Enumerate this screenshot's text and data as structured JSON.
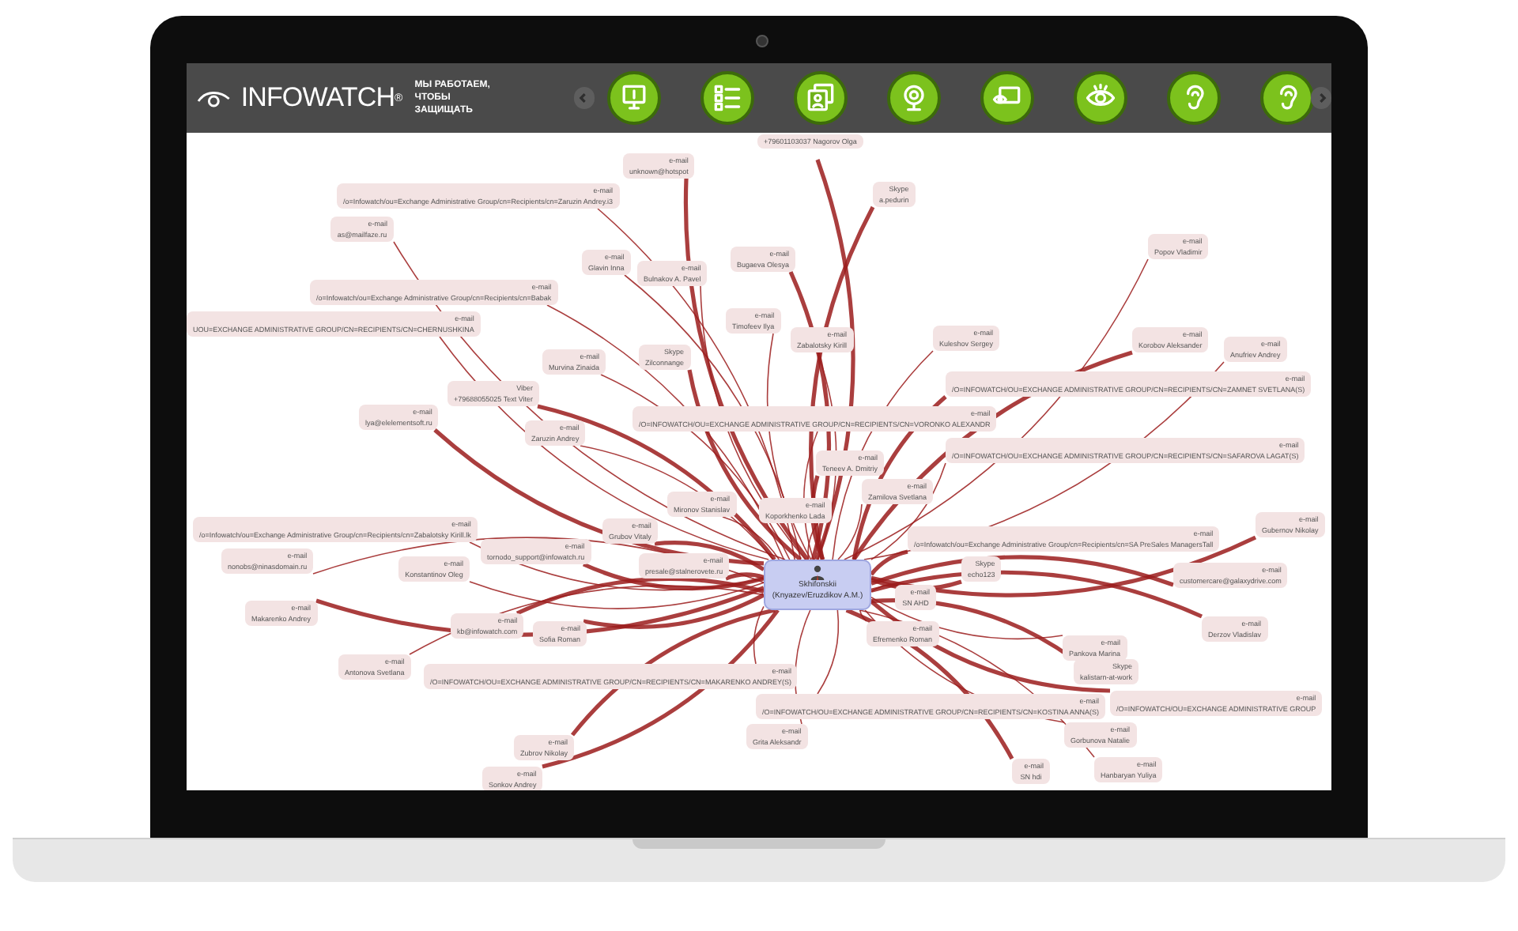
{
  "header": {
    "brand": "INFOWATCH",
    "brand_mark": "®",
    "tagline": [
      "МЫ РАБОТАЕМ,",
      "ЧТОБЫ ЗАЩИЩАТЬ"
    ],
    "toolbar": [
      {
        "kind": "monitor"
      },
      {
        "kind": "list"
      },
      {
        "kind": "cards"
      },
      {
        "kind": "webcam"
      },
      {
        "kind": "eye-screen"
      },
      {
        "kind": "eye"
      },
      {
        "kind": "ear"
      },
      {
        "kind": "ear"
      }
    ]
  },
  "hub": {
    "name": "Skhifonskii",
    "detail": "(Knyazev/Eruzdikov A.M.)"
  },
  "nodes": [
    {
      "type": "e-mail",
      "value": "unknown@hotspot",
      "kind": "thick"
    },
    {
      "type": "e-mail",
      "value": "/o=Infowatch/ou=Exchange Administrative Group/cn=Recipients/cn=Zaruzin Andrey.i3",
      "kind": "thin"
    },
    {
      "type": "e-mail",
      "value": "as@mailfaze.ru",
      "kind": "thin"
    },
    {
      "type": "e-mail",
      "value": "Glavin Inna",
      "kind": "thin"
    },
    {
      "type": "e-mail",
      "value": "Bulnakov A. Pavel",
      "kind": "thin"
    },
    {
      "type": "e-mail",
      "value": "/o=Infowatch/ou=Exchange Administrative Group/cn=Recipients/cn=Babak",
      "kind": "thin"
    },
    {
      "type": "e-mail",
      "value": "UOU=EXCHANGE ADMINISTRATIVE GROUP/CN=RECIPIENTS/CN=CHERNUSHKINA",
      "kind": "thin"
    },
    {
      "type": "e-mail",
      "value": "Murvina Zinaida",
      "kind": "thin"
    },
    {
      "type": "Skype",
      "value": "Zilconnange",
      "kind": "thick"
    },
    {
      "type": "Viber",
      "value": "+79688055025 Text Viter",
      "kind": "thick"
    },
    {
      "type": "e-mail",
      "value": "lya@elelementsoft.ru",
      "kind": "thick"
    },
    {
      "type": "e-mail",
      "value": "Zaruzin Andrey",
      "kind": "thin"
    },
    {
      "type": "e-mail",
      "value": "/O=INFOWATCH/OU=EXCHANGE ADMINISTRATIVE GROUP/CN=RECIPIENTS/CN=VORONKO ALEXANDR",
      "kind": "thin"
    },
    {
      "type": "e-mail",
      "value": "Bugaeva Olesya",
      "kind": "thick"
    },
    {
      "type": "e-mail",
      "value": "Timofeev Ilya",
      "kind": "thin"
    },
    {
      "value": "+79601103037 Nagorov Olga",
      "kind": "thick"
    },
    {
      "type": "Skype",
      "value": "a.pedurin",
      "kind": "thick"
    },
    {
      "type": "e-mail",
      "value": "Zabalotsky Kirill",
      "kind": "thin"
    },
    {
      "type": "e-mail",
      "value": "Kuleshov Sergey",
      "kind": "thin"
    },
    {
      "type": "e-mail",
      "value": "Popov Vladimir",
      "kind": "thin"
    },
    {
      "type": "e-mail",
      "value": "Korobov Aleksander",
      "kind": "thick"
    },
    {
      "type": "e-mail",
      "value": "Anufriev Andrey",
      "kind": "thin"
    },
    {
      "type": "e-mail",
      "value": "/O=INFOWATCH/OU=EXCHANGE ADMINISTRATIVE GROUP/CN=RECIPIENTS/CN=ZAMNET SVETLANA(S)",
      "kind": "thick"
    },
    {
      "type": "e-mail",
      "value": "/O=INFOWATCH/OU=EXCHANGE ADMINISTRATIVE GROUP/CN=RECIPIENTS/CN=SAFAROVA LAGAT(S)",
      "kind": "thin"
    },
    {
      "type": "e-mail",
      "value": "Teneev A. Dmitriy",
      "kind": "thick"
    },
    {
      "type": "e-mail",
      "value": "Zamilova Svetlana",
      "kind": "thin"
    },
    {
      "type": "e-mail",
      "value": "Koporkhenko Lada",
      "kind": "thin"
    },
    {
      "type": "e-mail",
      "value": "Mironov Stanislav",
      "kind": "thin"
    },
    {
      "type": "e-mail",
      "value": "/o=Infowatch/ou=Exchange Administrative Group/cn=Recipients/cn=Zabalotsky Kirill.lk",
      "kind": "thin"
    },
    {
      "type": "e-mail",
      "value": "Grubov Vitaly",
      "kind": "thick"
    },
    {
      "type": "e-mail",
      "value": "tornodo_support@infowatch.ru",
      "kind": "thick"
    },
    {
      "type": "e-mail",
      "value": "nonobs@ninasdomain.ru",
      "kind": "thin"
    },
    {
      "type": "e-mail",
      "value": "Konstantinov Oleg",
      "kind": "thin"
    },
    {
      "type": "e-mail",
      "value": "presale@stalnerovete.ru",
      "kind": "thick"
    },
    {
      "type": "e-mail",
      "value": "Makarenko Andrey",
      "kind": "thick"
    },
    {
      "type": "e-mail",
      "value": "kb@infowatch.com",
      "kind": "thick"
    },
    {
      "type": "e-mail",
      "value": "Sofia Roman",
      "kind": "thick"
    },
    {
      "type": "e-mail",
      "value": "Antonova Svetlana",
      "kind": "thin"
    },
    {
      "type": "e-mail",
      "value": "/o=Infowatch/ou=Exchange Administrative Group/cn=Recipients/cn=SA PreSales ManagersTall",
      "kind": "thick"
    },
    {
      "type": "Skype",
      "value": "echo123",
      "kind": "thick"
    },
    {
      "type": "e-mail",
      "value": "customercare@galaxydrive.com",
      "kind": "thick"
    },
    {
      "type": "e-mail",
      "value": "Gubernov Nikolay",
      "kind": "thick"
    },
    {
      "type": "e-mail",
      "value": "SN AHD",
      "kind": "thin"
    },
    {
      "type": "e-mail",
      "value": "Efremenko Roman",
      "kind": "thin"
    },
    {
      "type": "e-mail",
      "value": "Derzov Vladislav",
      "kind": "thick"
    },
    {
      "type": "e-mail",
      "value": "Pankova Marina",
      "kind": "thin"
    },
    {
      "type": "Skype",
      "value": "kalistarn-at-work",
      "kind": "thick"
    },
    {
      "type": "e-mail",
      "value": "/O=INFOWATCH/OU=EXCHANGE ADMINISTRATIVE GROUP/CN=RECIPIENTS/CN=MAKARENKO ANDREY(S)",
      "kind": "thin"
    },
    {
      "type": "e-mail",
      "value": "/O=INFOWATCH/OU=EXCHANGE ADMINISTRATIVE GROUP/CN=RECIPIENTS/CN=KOSTINA ANNA(S)",
      "kind": "thin"
    },
    {
      "type": "e-mail",
      "value": "/O=INFOWATCH/OU=EXCHANGE ADMINISTRATIVE GROUP",
      "kind": "thick"
    },
    {
      "type": "e-mail",
      "value": "SN hdi",
      "kind": "thick"
    },
    {
      "type": "e-mail",
      "value": "Gorbunova Natalie",
      "kind": "thin"
    },
    {
      "type": "e-mail",
      "value": "Hanbaryan Yuliya",
      "kind": "thin"
    },
    {
      "type": "e-mail",
      "value": "Zubrov Nikolay",
      "kind": "thick"
    },
    {
      "type": "e-mail",
      "value": "Sonkov Andrey",
      "kind": "thick"
    },
    {
      "type": "e-mail",
      "value": "Grita Aleksandr",
      "kind": "thin"
    }
  ]
}
